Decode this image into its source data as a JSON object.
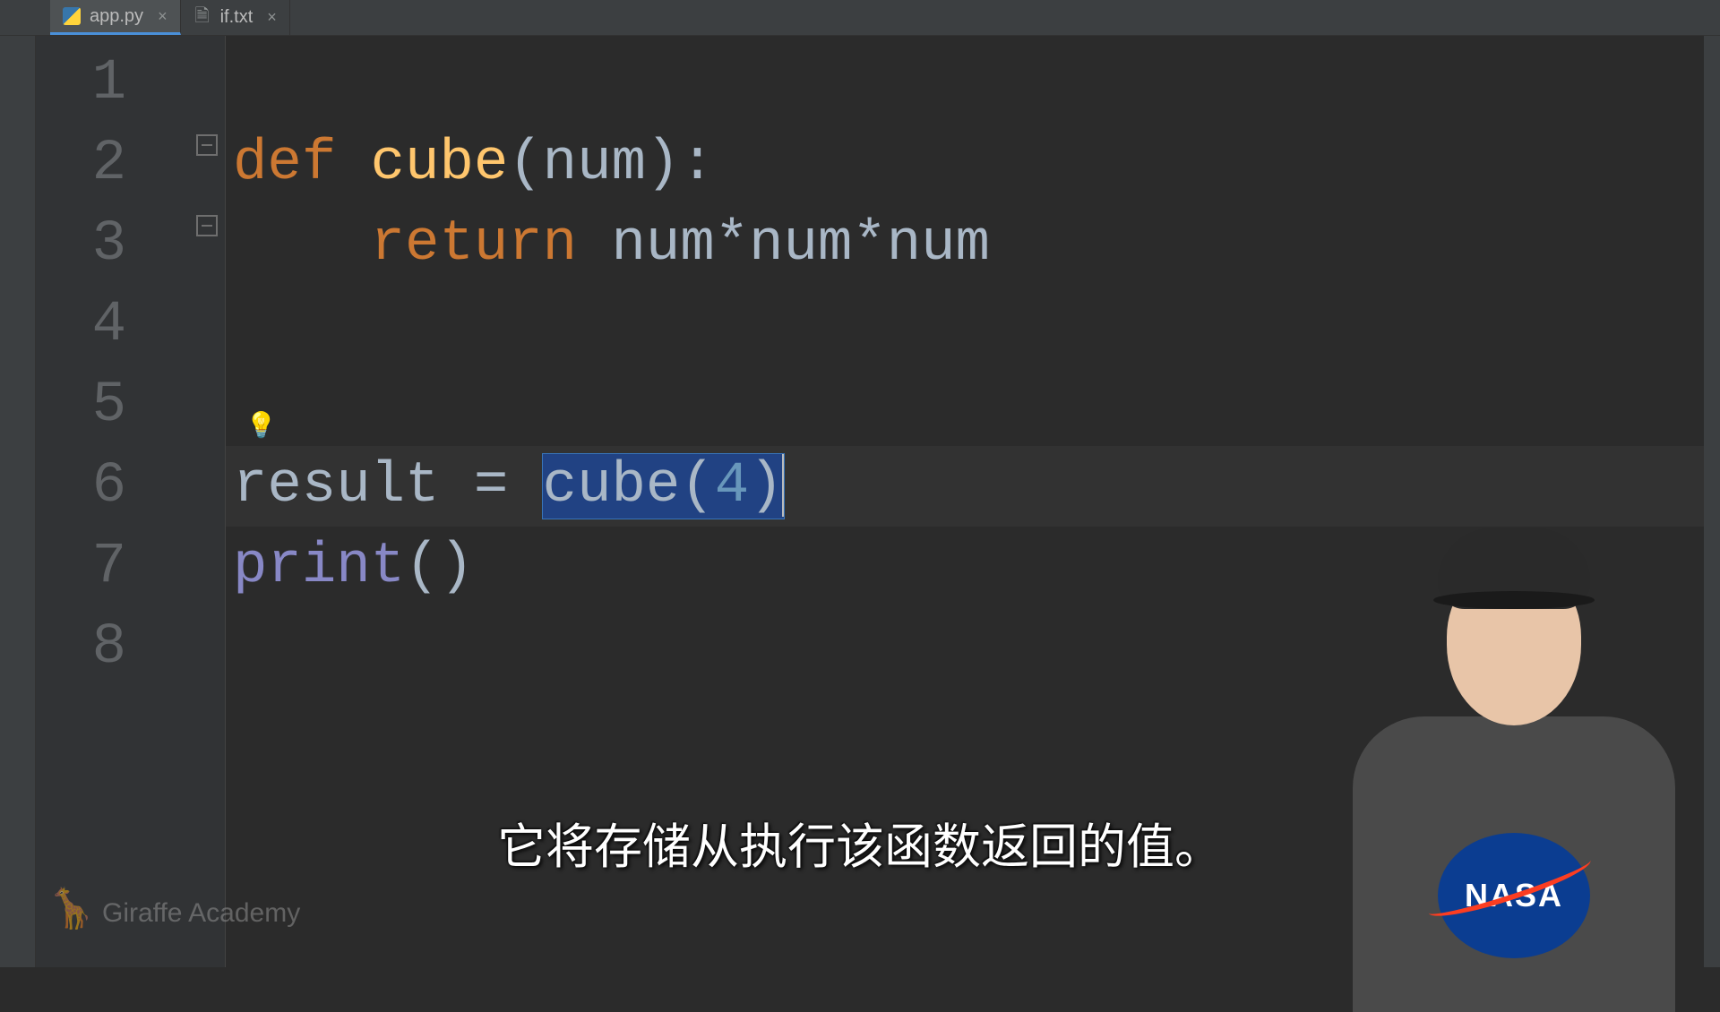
{
  "tabs": [
    {
      "name": "app.py",
      "active": true,
      "icon": "python"
    },
    {
      "name": "if.txt",
      "active": false,
      "icon": "file"
    }
  ],
  "gutter": {
    "lines": [
      "1",
      "2",
      "3",
      "4",
      "5",
      "6",
      "7",
      "8"
    ]
  },
  "code": {
    "line2": {
      "def": "def ",
      "name": "cube",
      "params": "(num):"
    },
    "line3": {
      "ret": "    return ",
      "expr": "num*num*num"
    },
    "line6": {
      "var": "result ",
      "eq": "= ",
      "call": "cube(",
      "arg": "4",
      "close": ")"
    },
    "line7": {
      "fn": "print",
      "parens": "()"
    }
  },
  "subtitle": "它将存储从执行该函数返回的值。",
  "watermark": "Giraffe Academy",
  "presenter": {
    "shirt_logo": "NASA"
  }
}
